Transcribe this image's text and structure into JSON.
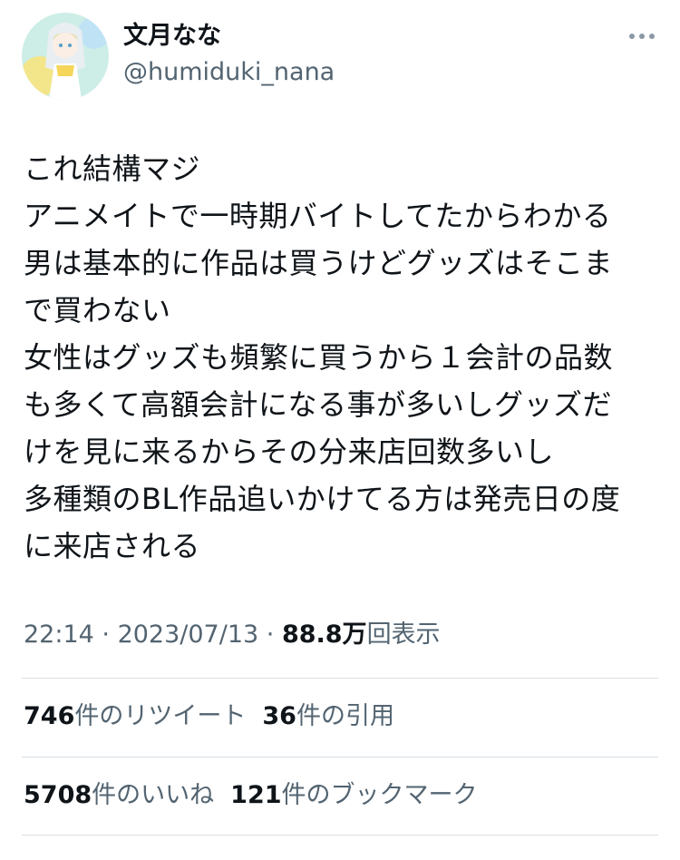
{
  "user": {
    "display_name": "文月なな",
    "handle": "@humiduki_nana",
    "more_icon": "ellipsis-icon"
  },
  "tweet": {
    "text": "これ結構マジ\nアニメイトで一時期バイトしてたからわかる\n男は基本的に作品は買うけどグッズはそこま\nで買わない\n女性はグッズも頻繁に買うから１会計の品数\nも多くて高額会計になる事が多いしグッズだ\nけを見に来るからその分来店回数多いし\n多種類のBL作品追いかけてる方は発売日の度\nに来店される",
    "time": "22:14",
    "sep1": " · ",
    "date": "2023/07/13",
    "sep2": " · ",
    "views_count": "88.8万",
    "views_label": "回表示"
  },
  "stats": {
    "retweets_count": "746",
    "retweets_label": "件のリツイート",
    "quotes_count": "36",
    "quotes_label": "件の引用",
    "likes_count": "5708",
    "likes_label": "件のいいね",
    "bookmarks_count": "121",
    "bookmarks_label": "件のブックマーク"
  },
  "colors": {
    "text": "#0f1419",
    "secondary": "#536471",
    "divider": "#d9dee2"
  }
}
